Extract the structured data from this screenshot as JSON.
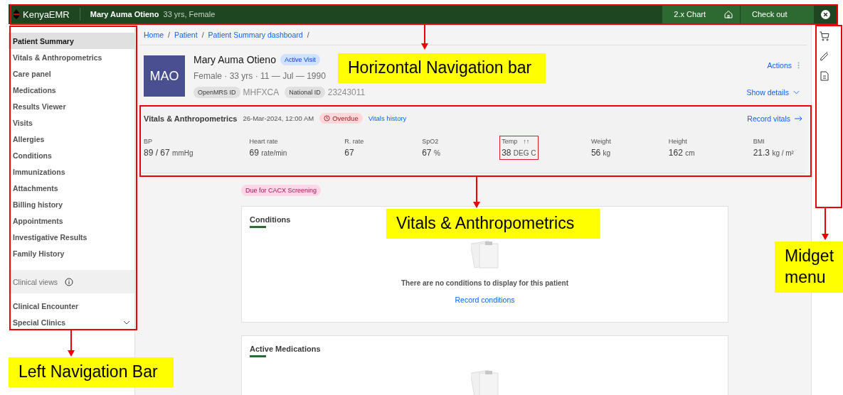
{
  "topbar": {
    "brand": "KenyaEMR",
    "patient_name": "Mary Auma Otieno",
    "patient_info": "33 yrs, Female",
    "buttons": [
      {
        "label": "2.x Chart"
      },
      {
        "label": "Check out"
      }
    ]
  },
  "left_nav": {
    "items": [
      {
        "label": "Patient Summary",
        "selected": true
      },
      {
        "label": "Vitals & Anthropometrics",
        "selected": false
      },
      {
        "label": "Care panel",
        "selected": false
      },
      {
        "label": "Medications",
        "selected": false
      },
      {
        "label": "Results Viewer",
        "selected": false
      },
      {
        "label": "Visits",
        "selected": false
      },
      {
        "label": "Allergies",
        "selected": false
      },
      {
        "label": "Conditions",
        "selected": false
      },
      {
        "label": "Immunizations",
        "selected": false
      },
      {
        "label": "Attachments",
        "selected": false
      },
      {
        "label": "Billing history",
        "selected": false
      },
      {
        "label": "Appointments",
        "selected": false
      },
      {
        "label": "Investigative Results",
        "selected": false
      },
      {
        "label": "Family History",
        "selected": false
      }
    ],
    "section": {
      "label": "Clinical views"
    },
    "section_items": [
      {
        "label": "Clinical Encounter"
      },
      {
        "label": "Special Clinics",
        "expanded": false
      }
    ]
  },
  "breadcrumb": {
    "separator": "/",
    "items": [
      "Home",
      "Patient",
      "Patient Summary dashboard"
    ]
  },
  "patient": {
    "initials": "MAO",
    "name": "Mary Auma Otieno",
    "badge": "Active Visit",
    "details": "Female · 33 yrs · 11 — Jul — 1990",
    "ids": [
      {
        "label": "OpenMRS ID",
        "value": "MHFXCA"
      },
      {
        "label": "National ID",
        "value": "23243011"
      }
    ],
    "actions": "Actions",
    "show_details": "Show details"
  },
  "vitals": {
    "title": "Vitals & Anthropometrics",
    "date": "26-Mar-2024, 12:00 AM",
    "status": "Overdue",
    "history_link": "Vitals history",
    "record_link": "Record vitals",
    "readings": [
      {
        "label": "BP",
        "value": "89 / 67",
        "unit": "mmHg",
        "abnormal": false
      },
      {
        "label": "Heart rate",
        "value": "69",
        "unit": "rate/min",
        "abnormal": false
      },
      {
        "label": "R. rate",
        "value": "67",
        "abnormal": false
      },
      {
        "label": "SpO2",
        "value": "67",
        "unit": "%",
        "abnormal": false
      },
      {
        "label": "Temp",
        "value": "38",
        "unit": "DEG C",
        "abnormal": true,
        "flag": "↑↑"
      },
      {
        "label": "Weight",
        "value": "56",
        "unit": "kg",
        "abnormal": false
      },
      {
        "label": "Height",
        "value": "162",
        "unit": "cm",
        "abnormal": false
      },
      {
        "label": "BMI",
        "value": "21.3",
        "unit": "kg / m²",
        "abnormal": false
      }
    ]
  },
  "due_tag": "Due for CACX Screening",
  "cards": [
    {
      "title": "Conditions",
      "empty_message": "There are no conditions to display for this patient",
      "action": "Record conditions"
    },
    {
      "title": "Active Medications"
    }
  ],
  "annotations": [
    {
      "label": "Horizontal Navigation bar"
    },
    {
      "label": "Vitals & Anthropometrics"
    },
    {
      "label": "Midget menu"
    },
    {
      "label": "Left Navigation Bar"
    }
  ]
}
